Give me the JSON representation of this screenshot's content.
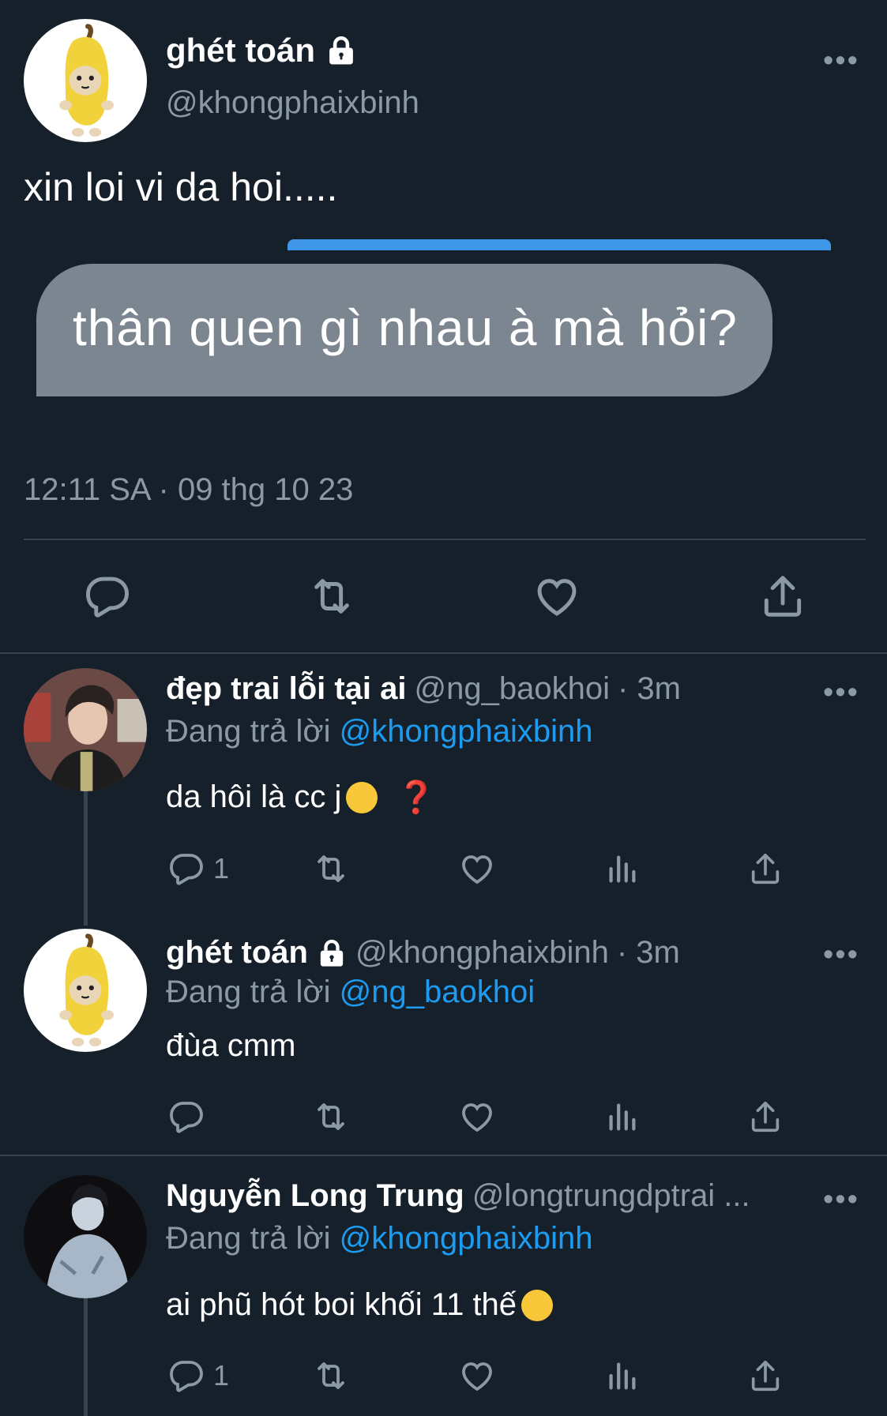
{
  "main_tweet": {
    "display_name": "ghét toán",
    "handle": "@khongphaixbinh",
    "text": "xin loi vi da hoi.....",
    "image_text": "thân quen gì nhau à mà hỏi?",
    "timestamp": "12:11 SA · 09 thg 10 23",
    "more": "•••"
  },
  "replies": [
    {
      "display_name": "đẹp trai lỗi tại ai",
      "handle": "@ng_baokhoi",
      "time": "· 3m",
      "replying_label": "Đang trả lời",
      "replying_to": "@khongphaixbinh",
      "text": "da hôi là cc j",
      "trailing": "❓",
      "reply_count": "1",
      "more": "•••"
    },
    {
      "display_name": "ghét toán",
      "handle": "@khongphaixbinh",
      "time": "· 3m",
      "replying_label": "Đang trả lời",
      "replying_to": "@ng_baokhoi",
      "text": "đùa cmm",
      "reply_count": "",
      "more": "•••"
    },
    {
      "display_name": "Nguyễn Long Trung",
      "handle": "@longtrungdptrai ...",
      "replying_label": "Đang trả lời",
      "replying_to": "@khongphaixbinh",
      "text": "ai phũ hót boi khối 11 thế",
      "reply_count": "1",
      "more": "•••"
    }
  ],
  "icons": {
    "reply": "speech-bubble-icon",
    "retweet": "retweet-icon",
    "like": "heart-icon",
    "views": "bar-chart-icon",
    "share": "share-icon",
    "lock": "lock-icon"
  },
  "colors": {
    "background": "#15202b",
    "text": "#ffffff",
    "muted": "#8b98a5",
    "link": "#1d9bf0",
    "divider": "#38444d"
  }
}
